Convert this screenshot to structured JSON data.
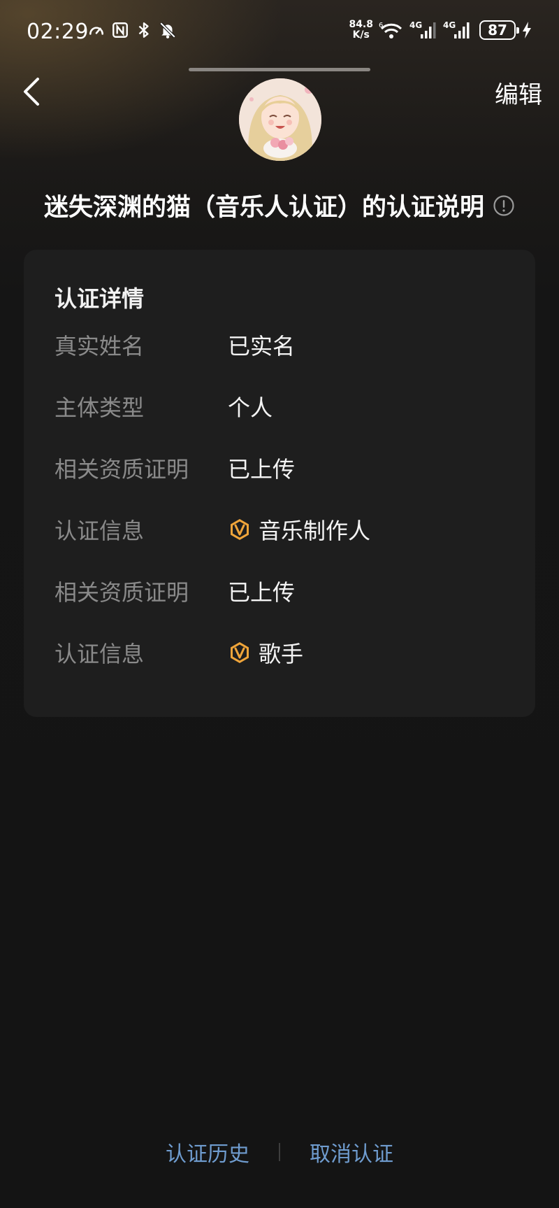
{
  "status_bar": {
    "time": "02:29",
    "speed_value": "84.8",
    "speed_unit": "K/s",
    "network_1": "4G",
    "network_2": "4G",
    "battery": "87"
  },
  "header": {
    "back_icon": "chevron-left-icon",
    "edit_label": "编辑"
  },
  "title": "迷失深渊的猫（音乐人认证）的认证说明",
  "card": {
    "title": "认证详情",
    "rows": [
      {
        "label": "真实姓名",
        "value": "已实名",
        "badge": false
      },
      {
        "label": "主体类型",
        "value": "个人",
        "badge": false
      },
      {
        "label": "相关资质证明",
        "value": "已上传",
        "badge": false
      },
      {
        "label": "认证信息",
        "value": "音乐制作人",
        "badge": true
      },
      {
        "label": "相关资质证明",
        "value": "已上传",
        "badge": false
      },
      {
        "label": "认证信息",
        "value": "歌手",
        "badge": true
      }
    ]
  },
  "footer": {
    "history_label": "认证历史",
    "cancel_label": "取消认证"
  },
  "colors": {
    "background": "#141414",
    "card": "#1e1e1e",
    "link": "#6f9ccf",
    "badge": "#f0a53a",
    "label": "#8a8a8a"
  }
}
